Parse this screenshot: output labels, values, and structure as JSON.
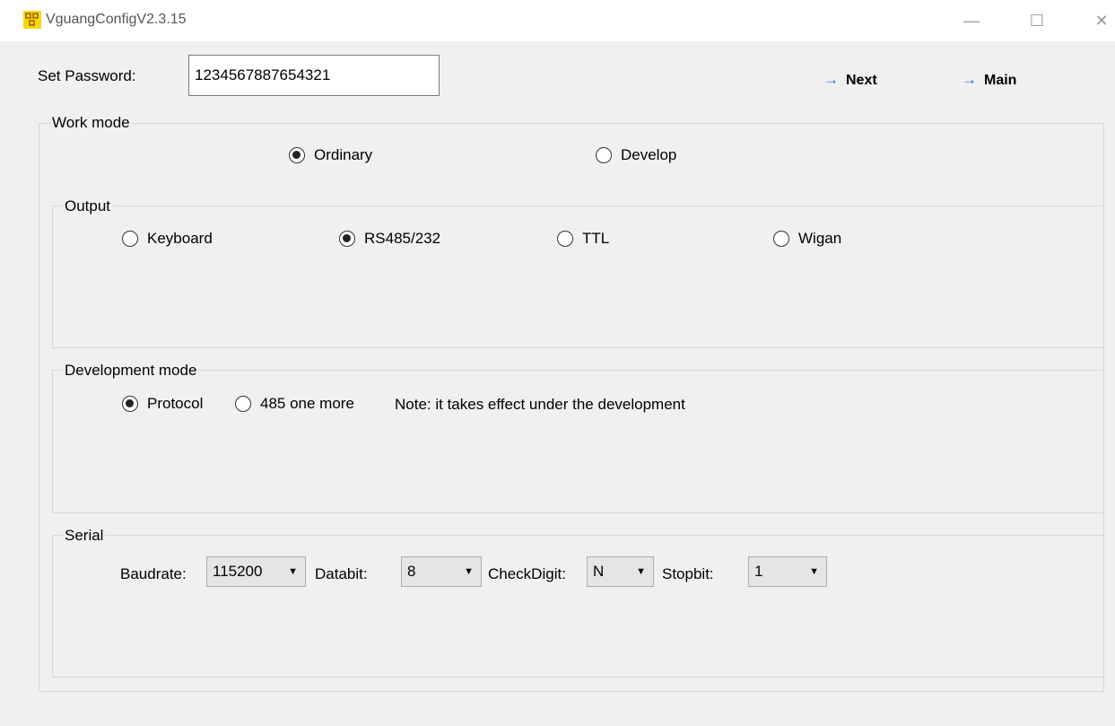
{
  "window": {
    "title": "VguangConfigV2.3.15",
    "min_glyph": "—",
    "max_glyph": "☐",
    "close_glyph": "✕"
  },
  "password": {
    "label": "Set Password:",
    "value": "1234567887654321"
  },
  "nav": {
    "next_label": "Next",
    "main_label": "Main",
    "arrow": "→"
  },
  "work_mode": {
    "legend": "Work mode",
    "options": [
      {
        "label": "Ordinary",
        "checked": true
      },
      {
        "label": "Develop",
        "checked": false
      }
    ]
  },
  "output": {
    "legend": "Output",
    "options": [
      {
        "label": "Keyboard",
        "checked": false
      },
      {
        "label": "RS485/232",
        "checked": true
      },
      {
        "label": "TTL",
        "checked": false
      },
      {
        "label": "Wigan",
        "checked": false
      }
    ]
  },
  "development_mode": {
    "legend": "Development mode",
    "options": [
      {
        "label": "Protocol",
        "checked": true
      },
      {
        "label": "485 one more",
        "checked": false
      }
    ],
    "note": "Note: it takes effect under the development"
  },
  "serial": {
    "legend": "Serial",
    "baudrate_label": "Baudrate:",
    "baudrate_value": "115200",
    "databit_label": "Databit:",
    "databit_value": "8",
    "checkdigit_label": "CheckDigit:",
    "checkdigit_value": "N",
    "stopbit_label": "Stopbit:",
    "stopbit_value": "1"
  },
  "colors": {
    "accent": "#1a6fd6",
    "background": "#f0f0f0",
    "titlebar": "#ffffff"
  }
}
